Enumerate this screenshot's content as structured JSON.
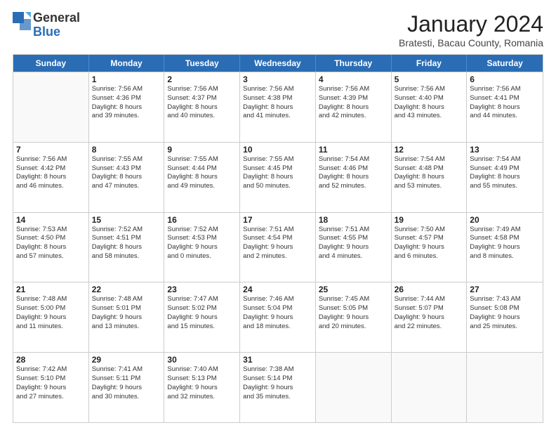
{
  "logo": {
    "general": "General",
    "blue": "Blue"
  },
  "header": {
    "month": "January 2024",
    "location": "Bratesti, Bacau County, Romania"
  },
  "weekdays": [
    "Sunday",
    "Monday",
    "Tuesday",
    "Wednesday",
    "Thursday",
    "Friday",
    "Saturday"
  ],
  "weeks": [
    [
      {
        "day": "",
        "sunrise": "",
        "sunset": "",
        "daylight": ""
      },
      {
        "day": "1",
        "sunrise": "Sunrise: 7:56 AM",
        "sunset": "Sunset: 4:36 PM",
        "daylight": "Daylight: 8 hours and 39 minutes."
      },
      {
        "day": "2",
        "sunrise": "Sunrise: 7:56 AM",
        "sunset": "Sunset: 4:37 PM",
        "daylight": "Daylight: 8 hours and 40 minutes."
      },
      {
        "day": "3",
        "sunrise": "Sunrise: 7:56 AM",
        "sunset": "Sunset: 4:38 PM",
        "daylight": "Daylight: 8 hours and 41 minutes."
      },
      {
        "day": "4",
        "sunrise": "Sunrise: 7:56 AM",
        "sunset": "Sunset: 4:39 PM",
        "daylight": "Daylight: 8 hours and 42 minutes."
      },
      {
        "day": "5",
        "sunrise": "Sunrise: 7:56 AM",
        "sunset": "Sunset: 4:40 PM",
        "daylight": "Daylight: 8 hours and 43 minutes."
      },
      {
        "day": "6",
        "sunrise": "Sunrise: 7:56 AM",
        "sunset": "Sunset: 4:41 PM",
        "daylight": "Daylight: 8 hours and 44 minutes."
      }
    ],
    [
      {
        "day": "7",
        "sunrise": "Sunrise: 7:56 AM",
        "sunset": "Sunset: 4:42 PM",
        "daylight": "Daylight: 8 hours and 46 minutes."
      },
      {
        "day": "8",
        "sunrise": "Sunrise: 7:55 AM",
        "sunset": "Sunset: 4:43 PM",
        "daylight": "Daylight: 8 hours and 47 minutes."
      },
      {
        "day": "9",
        "sunrise": "Sunrise: 7:55 AM",
        "sunset": "Sunset: 4:44 PM",
        "daylight": "Daylight: 8 hours and 49 minutes."
      },
      {
        "day": "10",
        "sunrise": "Sunrise: 7:55 AM",
        "sunset": "Sunset: 4:45 PM",
        "daylight": "Daylight: 8 hours and 50 minutes."
      },
      {
        "day": "11",
        "sunrise": "Sunrise: 7:54 AM",
        "sunset": "Sunset: 4:46 PM",
        "daylight": "Daylight: 8 hours and 52 minutes."
      },
      {
        "day": "12",
        "sunrise": "Sunrise: 7:54 AM",
        "sunset": "Sunset: 4:48 PM",
        "daylight": "Daylight: 8 hours and 53 minutes."
      },
      {
        "day": "13",
        "sunrise": "Sunrise: 7:54 AM",
        "sunset": "Sunset: 4:49 PM",
        "daylight": "Daylight: 8 hours and 55 minutes."
      }
    ],
    [
      {
        "day": "14",
        "sunrise": "Sunrise: 7:53 AM",
        "sunset": "Sunset: 4:50 PM",
        "daylight": "Daylight: 8 hours and 57 minutes."
      },
      {
        "day": "15",
        "sunrise": "Sunrise: 7:52 AM",
        "sunset": "Sunset: 4:51 PM",
        "daylight": "Daylight: 8 hours and 58 minutes."
      },
      {
        "day": "16",
        "sunrise": "Sunrise: 7:52 AM",
        "sunset": "Sunset: 4:53 PM",
        "daylight": "Daylight: 9 hours and 0 minutes."
      },
      {
        "day": "17",
        "sunrise": "Sunrise: 7:51 AM",
        "sunset": "Sunset: 4:54 PM",
        "daylight": "Daylight: 9 hours and 2 minutes."
      },
      {
        "day": "18",
        "sunrise": "Sunrise: 7:51 AM",
        "sunset": "Sunset: 4:55 PM",
        "daylight": "Daylight: 9 hours and 4 minutes."
      },
      {
        "day": "19",
        "sunrise": "Sunrise: 7:50 AM",
        "sunset": "Sunset: 4:57 PM",
        "daylight": "Daylight: 9 hours and 6 minutes."
      },
      {
        "day": "20",
        "sunrise": "Sunrise: 7:49 AM",
        "sunset": "Sunset: 4:58 PM",
        "daylight": "Daylight: 9 hours and 8 minutes."
      }
    ],
    [
      {
        "day": "21",
        "sunrise": "Sunrise: 7:48 AM",
        "sunset": "Sunset: 5:00 PM",
        "daylight": "Daylight: 9 hours and 11 minutes."
      },
      {
        "day": "22",
        "sunrise": "Sunrise: 7:48 AM",
        "sunset": "Sunset: 5:01 PM",
        "daylight": "Daylight: 9 hours and 13 minutes."
      },
      {
        "day": "23",
        "sunrise": "Sunrise: 7:47 AM",
        "sunset": "Sunset: 5:02 PM",
        "daylight": "Daylight: 9 hours and 15 minutes."
      },
      {
        "day": "24",
        "sunrise": "Sunrise: 7:46 AM",
        "sunset": "Sunset: 5:04 PM",
        "daylight": "Daylight: 9 hours and 18 minutes."
      },
      {
        "day": "25",
        "sunrise": "Sunrise: 7:45 AM",
        "sunset": "Sunset: 5:05 PM",
        "daylight": "Daylight: 9 hours and 20 minutes."
      },
      {
        "day": "26",
        "sunrise": "Sunrise: 7:44 AM",
        "sunset": "Sunset: 5:07 PM",
        "daylight": "Daylight: 9 hours and 22 minutes."
      },
      {
        "day": "27",
        "sunrise": "Sunrise: 7:43 AM",
        "sunset": "Sunset: 5:08 PM",
        "daylight": "Daylight: 9 hours and 25 minutes."
      }
    ],
    [
      {
        "day": "28",
        "sunrise": "Sunrise: 7:42 AM",
        "sunset": "Sunset: 5:10 PM",
        "daylight": "Daylight: 9 hours and 27 minutes."
      },
      {
        "day": "29",
        "sunrise": "Sunrise: 7:41 AM",
        "sunset": "Sunset: 5:11 PM",
        "daylight": "Daylight: 9 hours and 30 minutes."
      },
      {
        "day": "30",
        "sunrise": "Sunrise: 7:40 AM",
        "sunset": "Sunset: 5:13 PM",
        "daylight": "Daylight: 9 hours and 32 minutes."
      },
      {
        "day": "31",
        "sunrise": "Sunrise: 7:38 AM",
        "sunset": "Sunset: 5:14 PM",
        "daylight": "Daylight: 9 hours and 35 minutes."
      },
      {
        "day": "",
        "sunrise": "",
        "sunset": "",
        "daylight": ""
      },
      {
        "day": "",
        "sunrise": "",
        "sunset": "",
        "daylight": ""
      },
      {
        "day": "",
        "sunrise": "",
        "sunset": "",
        "daylight": ""
      }
    ]
  ]
}
